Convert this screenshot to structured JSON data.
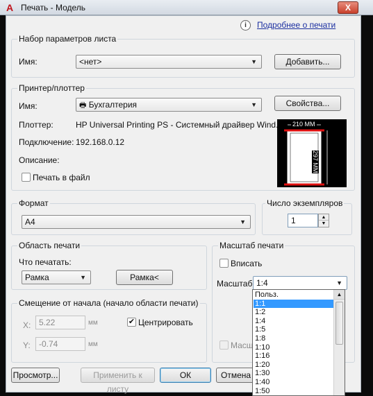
{
  "window": {
    "app_icon": "autocad-a-icon",
    "title": "Печать - Модель",
    "close_glyph": "X",
    "info_glyph": "i",
    "info_link": "Подробнее о печати"
  },
  "page_setup": {
    "group_title": "Набор параметров листа",
    "name_label": "Имя:",
    "name_value": "<нет>",
    "add_button": "Добавить..."
  },
  "printer": {
    "group_title": "Принтер/плоттер",
    "name_label": "Имя:",
    "name_value": "Бухгалтерия",
    "properties_button": "Свойства...",
    "plotter_label": "Плоттер:",
    "plotter_value": "HP Universal Printing PS - Системный драйвер Wind...",
    "connection_label": "Подключение:",
    "connection_value": "192.168.0.12",
    "description_label": "Описание:",
    "print_to_file_label": "Печать в файл",
    "print_to_file_checked": false,
    "preview_width_label": "210  ММ",
    "preview_height_label": "297  ММ"
  },
  "format": {
    "group_title": "Формат",
    "value": "A4"
  },
  "copies": {
    "group_title": "Число экземпляров",
    "value": "1"
  },
  "print_area": {
    "group_title": "Область печати",
    "what_label": "Что печатать:",
    "what_value": "Рамка",
    "window_button": "Рамка<"
  },
  "offset": {
    "group_title": "Смещение от начала (начало области печати)",
    "x_label": "X:",
    "x_value": "5.22",
    "x_unit": "мм",
    "y_label": "Y:",
    "y_value": "-0.74",
    "y_unit": "мм",
    "center_label": "Центрировать",
    "center_checked": true
  },
  "plot_scale": {
    "group_title": "Масштаб печати",
    "fit_label": "Вписать",
    "fit_checked": false,
    "scale_label": "Масштаб:",
    "scale_value": "1:4",
    "lineweights_label": "Масшта",
    "options": [
      "Польз.",
      "1:1",
      "1:2",
      "1:4",
      "1:5",
      "1:8",
      "1:10",
      "1:16",
      "1:20",
      "1:30",
      "1:40",
      "1:50"
    ],
    "highlighted_option": "1:1"
  },
  "footer": {
    "preview_button": "Просмотр...",
    "apply_button": "Применить к листу",
    "ok_button": "ОК",
    "cancel_button": "Отмена"
  },
  "colors": {
    "highlight": "#3399ff",
    "preview_margin": "#e01010",
    "link": "#1a2ea0"
  }
}
